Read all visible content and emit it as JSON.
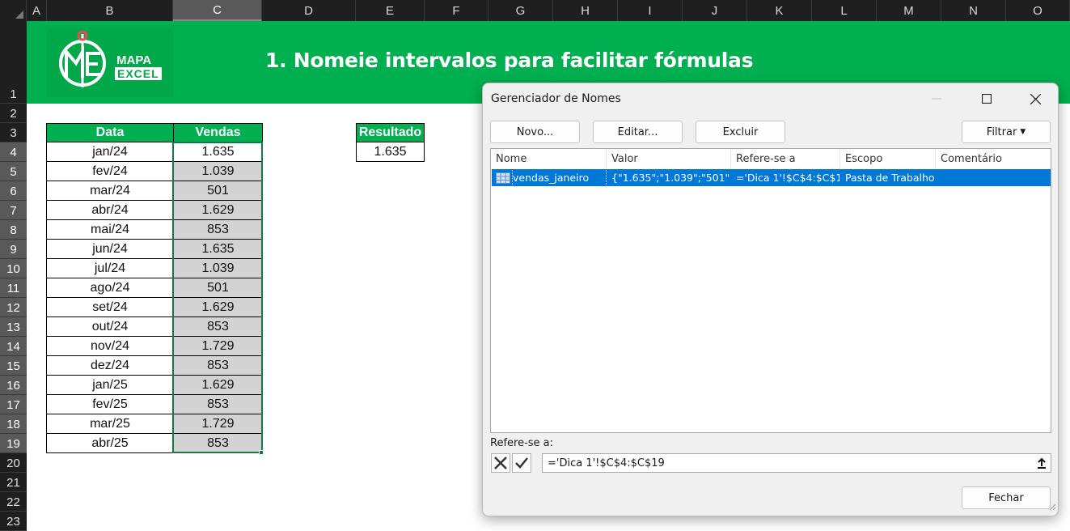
{
  "sheet": {
    "columns": [
      "A",
      "B",
      "C",
      "D",
      "E",
      "F",
      "G",
      "H",
      "I",
      "J",
      "K",
      "L",
      "M",
      "N",
      "O"
    ],
    "selected_column": "C",
    "rows": [
      "1",
      "2",
      "3",
      "4",
      "5",
      "6",
      "7",
      "8",
      "9",
      "10",
      "11",
      "12",
      "13",
      "14",
      "15",
      "16",
      "17",
      "18",
      "19",
      "20",
      "21",
      "22",
      "23"
    ],
    "selected_rows": [
      "4",
      "5",
      "6",
      "7",
      "8",
      "9",
      "10",
      "11",
      "12",
      "13",
      "14",
      "15",
      "16",
      "17",
      "18",
      "19"
    ]
  },
  "banner": {
    "logo_line1": "MAPA",
    "logo_line2": "EXCEL",
    "title": "1. Nomeie intervalos para facilitar fórmulas",
    "color": "#00b050"
  },
  "table": {
    "headers": [
      "Data",
      "Vendas"
    ],
    "rows": [
      [
        "jan/24",
        "1.635"
      ],
      [
        "fev/24",
        "1.039"
      ],
      [
        "mar/24",
        "501"
      ],
      [
        "abr/24",
        "1.629"
      ],
      [
        "mai/24",
        "853"
      ],
      [
        "jun/24",
        "1.635"
      ],
      [
        "jul/24",
        "1.039"
      ],
      [
        "ago/24",
        "501"
      ],
      [
        "set/24",
        "1.629"
      ],
      [
        "out/24",
        "853"
      ],
      [
        "nov/24",
        "1.729"
      ],
      [
        "dez/24",
        "853"
      ],
      [
        "jan/25",
        "1.629"
      ],
      [
        "fev/25",
        "853"
      ],
      [
        "mar/25",
        "1.729"
      ],
      [
        "abr/25",
        "853"
      ]
    ]
  },
  "result": {
    "header": "Resultado",
    "value": "1.635"
  },
  "dialog": {
    "title": "Gerenciador de Nomes",
    "buttons": {
      "new": "Novo...",
      "edit": "Editar...",
      "delete": "Excluir",
      "filter": "Filtrar",
      "close": "Fechar"
    },
    "columns": [
      "Nome",
      "Valor",
      "Refere-se a",
      "Escopo",
      "Comentário"
    ],
    "entries": [
      {
        "name": "vendas_janeiro",
        "value": "{\"1.635\";\"1.039\";\"501\";\"...",
        "refers_to": "='Dica 1'!$C$4:$C$19",
        "scope": "Pasta de Trabalho",
        "comment": ""
      }
    ],
    "refers_label": "Refere-se a:",
    "refers_value": "='Dica 1'!$C$4:$C$19",
    "selection_color": "#0078d7"
  }
}
